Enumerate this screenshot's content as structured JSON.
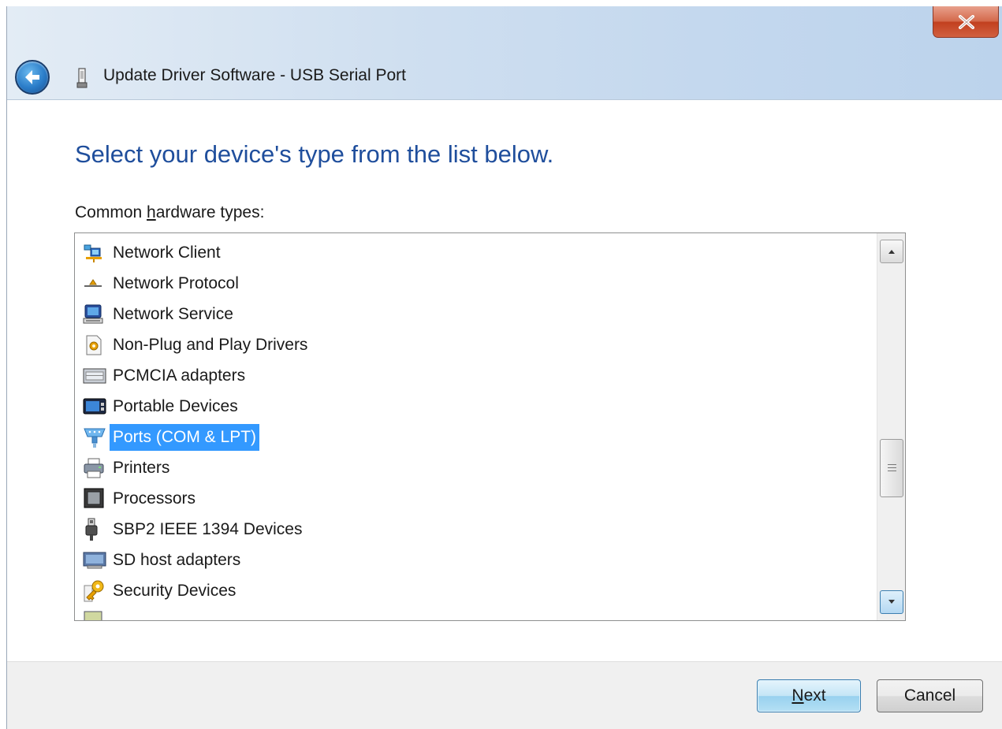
{
  "window": {
    "title": "Update Driver Software - USB Serial Port",
    "close_label": "X"
  },
  "page": {
    "heading": "Select your device's type from the list below.",
    "list_label_pre": "Common ",
    "list_label_accel": "h",
    "list_label_post": "ardware types:"
  },
  "hardware_list": {
    "items": [
      {
        "label": "Network Client",
        "icon": "network-client-icon"
      },
      {
        "label": "Network Protocol",
        "icon": "network-protocol-icon"
      },
      {
        "label": "Network Service",
        "icon": "network-service-icon"
      },
      {
        "label": "Non-Plug and Play Drivers",
        "icon": "non-pnp-driver-icon"
      },
      {
        "label": "PCMCIA adapters",
        "icon": "pcmcia-icon"
      },
      {
        "label": "Portable Devices",
        "icon": "portable-device-icon"
      },
      {
        "label": "Ports (COM & LPT)",
        "icon": "port-icon",
        "selected": true
      },
      {
        "label": "Printers",
        "icon": "printer-icon"
      },
      {
        "label": "Processors",
        "icon": "processor-icon"
      },
      {
        "label": "SBP2 IEEE 1394 Devices",
        "icon": "ieee1394-icon"
      },
      {
        "label": "SD host adapters",
        "icon": "sd-host-icon"
      },
      {
        "label": "Security Devices",
        "icon": "security-key-icon"
      }
    ]
  },
  "buttons": {
    "next_accel": "N",
    "next_rest": "ext",
    "cancel": "Cancel"
  },
  "colors": {
    "heading": "#1f4e9c",
    "selection": "#3399ff"
  }
}
